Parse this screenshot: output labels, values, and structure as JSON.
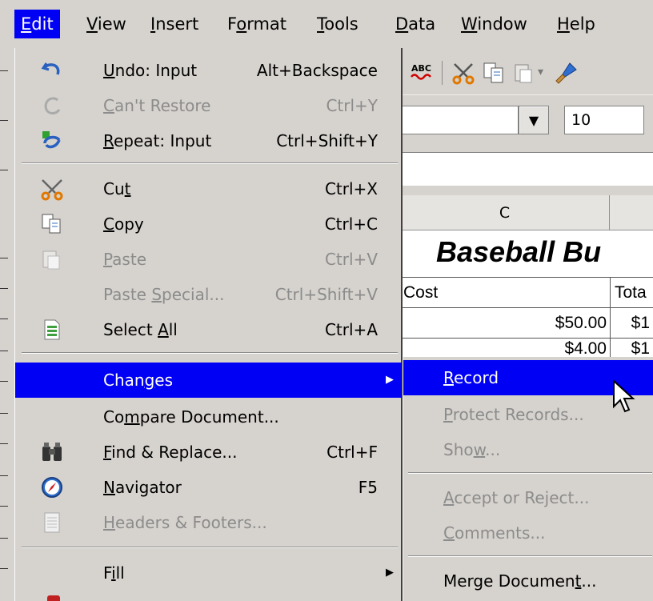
{
  "menubar": {
    "items": [
      "Edit",
      "View",
      "Insert",
      "Format",
      "Tools",
      "Data",
      "Window",
      "Help"
    ]
  },
  "toolbar": {
    "icons": [
      "spellcheck-icon",
      "cut-icon",
      "copy-icon",
      "paste-icon",
      "format-paintbrush-icon"
    ],
    "spellcheck_label": "ABC",
    "font_size": "10"
  },
  "sheet": {
    "column_header": "C",
    "title": "Baseball Bu",
    "header_cost": "Cost",
    "header_total": "Tota",
    "row1_cost": "$50.00",
    "row1_total": "$1",
    "row2_cost": "$4.00",
    "row2_total": "$1"
  },
  "edit_menu": {
    "undo": {
      "label": "Undo: Input",
      "shortcut": "Alt+Backspace",
      "icon": "undo-icon"
    },
    "restore": {
      "label": "Can't Restore",
      "shortcut": "Ctrl+Y",
      "icon": "restore-icon"
    },
    "repeat": {
      "label": "Repeat: Input",
      "shortcut": "Ctrl+Shift+Y",
      "icon": "repeat-icon"
    },
    "cut": {
      "label": "Cut",
      "shortcut": "Ctrl+X",
      "icon": "scissors-icon"
    },
    "copy": {
      "label": "Copy",
      "shortcut": "Ctrl+C",
      "icon": "copy-icon"
    },
    "paste": {
      "label": "Paste",
      "shortcut": "Ctrl+V",
      "icon": "paste-icon"
    },
    "paste_special": {
      "label": "Paste Special...",
      "shortcut": "Ctrl+Shift+V"
    },
    "select_all": {
      "label": "Select All",
      "shortcut": "Ctrl+A",
      "icon": "select-all-icon"
    },
    "changes": {
      "label": "Changes"
    },
    "compare": {
      "label": "Compare Document..."
    },
    "find_replace": {
      "label": "Find & Replace...",
      "shortcut": "Ctrl+F",
      "icon": "binoculars-icon"
    },
    "navigator": {
      "label": "Navigator",
      "shortcut": "F5",
      "icon": "compass-icon"
    },
    "headers_footers": {
      "label": "Headers & Footers...",
      "icon": "document-icon"
    },
    "fill": {
      "label": "Fill"
    }
  },
  "changes_submenu": {
    "record": "Record",
    "protect": "Protect Records...",
    "show": "Show...",
    "accept": "Accept or Reject...",
    "comments": "Comments...",
    "merge": "Merge Document..."
  },
  "colors": {
    "highlight": "#0000f5",
    "menu_bg": "#d6d3ce",
    "disabled_text": "#8c8c8c"
  }
}
